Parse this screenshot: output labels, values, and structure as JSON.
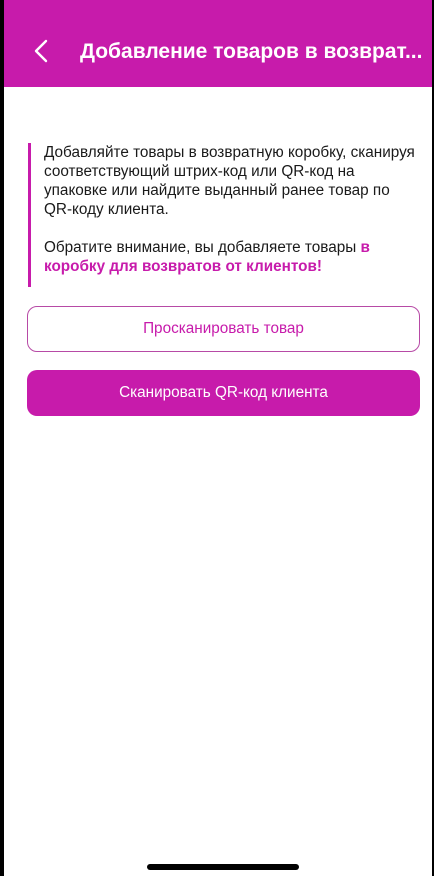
{
  "header": {
    "title": "Добавление товаров в возврат...",
    "back_icon": "chevron-left-icon"
  },
  "notice": {
    "line1": "Добавляйте товары в возвратную коробку, сканируя соответствующий штрих-код или QR-код на упаковке или найдите выданный ранее товар по QR-коду клиента.",
    "line2_prefix": "Обратите внимание, вы добавляете товары ",
    "line2_highlight": "в коробку для возвратов от клиентов!"
  },
  "buttons": {
    "scan_item": "Просканировать товар",
    "scan_client_qr": "Сканировать QR-код клиента"
  },
  "colors": {
    "accent": "#c71bab",
    "background": "#ffffff",
    "text": "#1a1a1a"
  }
}
